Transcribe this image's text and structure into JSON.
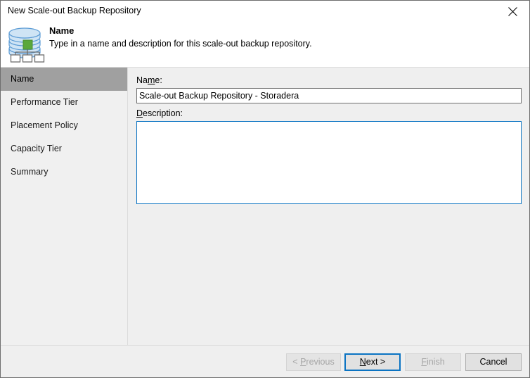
{
  "window": {
    "title": "New Scale-out Backup Repository",
    "close_icon": "close-icon"
  },
  "header": {
    "icon": "scale-out-backup-repository-icon",
    "title": "Name",
    "subtitle": "Type in a name and description for this scale-out backup repository."
  },
  "sidebar": {
    "items": [
      {
        "label": "Name",
        "selected": true
      },
      {
        "label": "Performance Tier",
        "selected": false
      },
      {
        "label": "Placement Policy",
        "selected": false
      },
      {
        "label": "Capacity Tier",
        "selected": false
      },
      {
        "label": "Summary",
        "selected": false
      }
    ]
  },
  "main": {
    "name_label_pre": "Na",
    "name_label_acc": "m",
    "name_label_post": "e:",
    "name_value": "Scale-out Backup Repository - Storadera",
    "name_placeholder": "",
    "description_label_acc": "D",
    "description_label_post": "escription:",
    "description_value": "",
    "description_placeholder": ""
  },
  "footer": {
    "previous": {
      "pre": "< ",
      "acc": "P",
      "post": "revious",
      "enabled": false
    },
    "next": {
      "pre": "",
      "acc": "N",
      "post": "ext >",
      "enabled": true,
      "default": true
    },
    "finish": {
      "pre": "",
      "acc": "F",
      "post": "inish",
      "enabled": false
    },
    "cancel": {
      "pre": "",
      "acc": "",
      "post": "Cancel",
      "enabled": true
    }
  },
  "colors": {
    "accent": "#0a73c2",
    "selection": "#a0a0a0",
    "dialog_bg": "#efefef",
    "sidebar_bg": "#f0f0f0",
    "icon_green": "#5aa83c",
    "icon_blue": "#b7d7ef"
  }
}
